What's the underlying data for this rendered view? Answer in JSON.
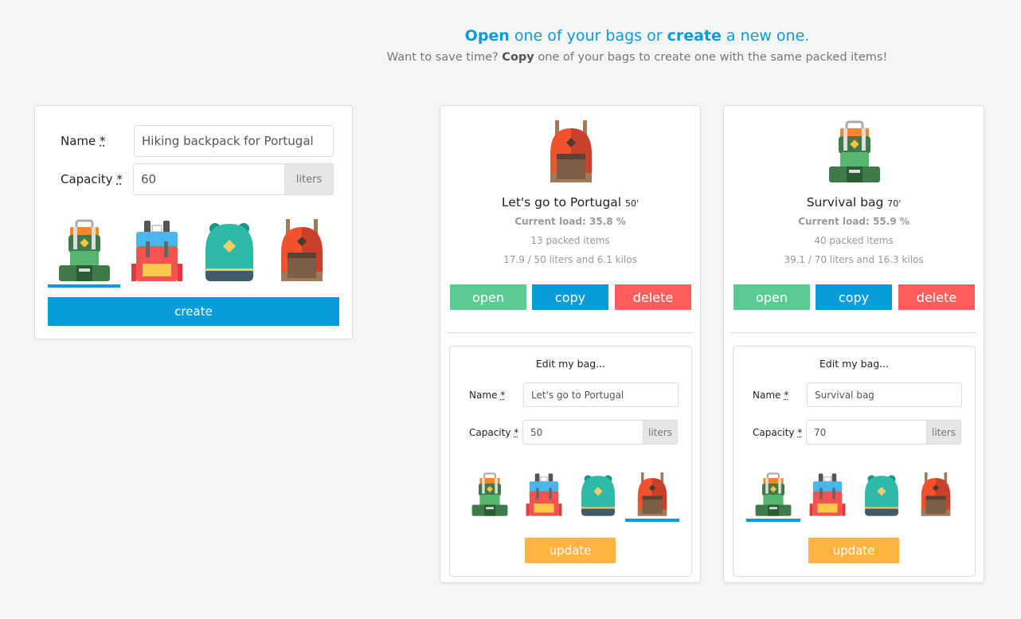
{
  "header": {
    "title_open": "Open",
    "title_mid": " one of your bags or ",
    "title_create": "create",
    "title_end": " a new one.",
    "sub_start": "Want to save time? ",
    "sub_copy": "Copy",
    "sub_end": " one of your bags to create one with the same packed items!"
  },
  "create_form": {
    "name_label": "Name",
    "capacity_label": "Capacity",
    "required_mark": "*",
    "name_value": "Hiking backpack for Portugal",
    "capacity_value": "60",
    "unit": "liters",
    "create_label": "create",
    "icons": [
      "green-backpack-icon",
      "blue-red-backpack-icon",
      "teal-backpack-icon",
      "red-brown-backpack-icon"
    ],
    "selected_icon": 0
  },
  "bags": [
    {
      "name": "Let's go to Portugal",
      "capacity": "50'",
      "load": "Current load: 35.8 %",
      "items": "13 packed items",
      "volume": "17.9 / 50 liters and 6.1 kilos",
      "icon": "red-brown-backpack-icon",
      "open": "open",
      "copy": "copy",
      "delete": "delete",
      "edit": {
        "title": "Edit my bag...",
        "name_label": "Name",
        "capacity_label": "Capacity",
        "required_mark": "*",
        "name_value": "Let's go to Portugal",
        "capacity_value": "50",
        "unit": "liters",
        "update": "update",
        "selected_icon": 3
      }
    },
    {
      "name": "Survival bag",
      "capacity": "70'",
      "load": "Current load: 55.9 %",
      "items": "40 packed items",
      "volume": "39.1 / 70 liters and 16.3 kilos",
      "icon": "green-backpack-icon",
      "open": "open",
      "copy": "copy",
      "delete": "delete",
      "edit": {
        "title": "Edit my bag...",
        "name_label": "Name",
        "capacity_label": "Capacity",
        "required_mark": "*",
        "name_value": "Survival bag",
        "capacity_value": "70",
        "unit": "liters",
        "update": "update",
        "selected_icon": 0
      }
    }
  ]
}
